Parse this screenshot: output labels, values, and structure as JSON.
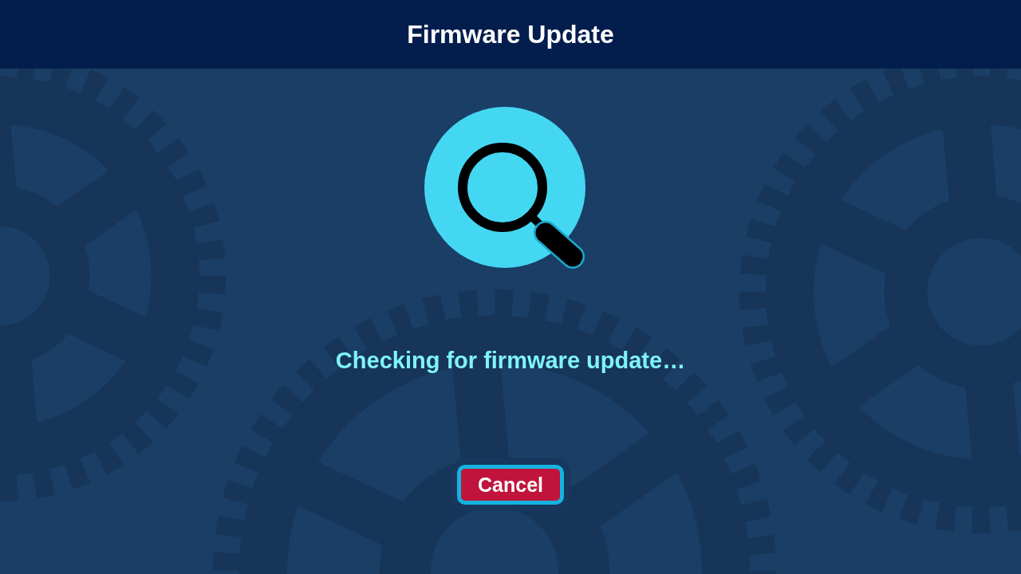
{
  "header": {
    "title": "Firmware Update"
  },
  "status": {
    "message": "Checking for firmware update…"
  },
  "cancel_button": {
    "label": "Cancel",
    "focused": true
  }
}
